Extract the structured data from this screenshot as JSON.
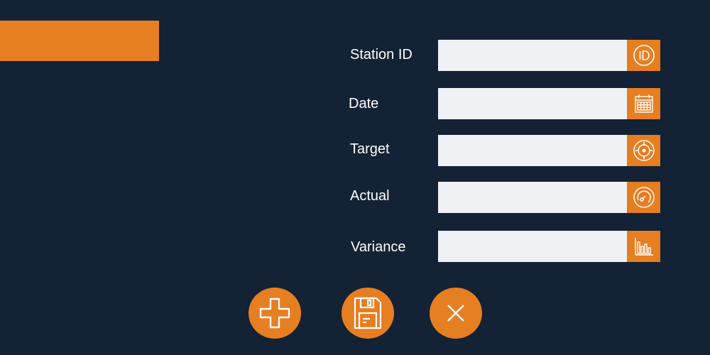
{
  "colors": {
    "background": "#132234",
    "accent": "#e67e22",
    "field_bg": "#f0f1f5",
    "text": "#ffffff"
  },
  "form": {
    "fields": [
      {
        "label": "Station ID",
        "value": "",
        "icon": "id-icon"
      },
      {
        "label": "Date",
        "value": "",
        "icon": "calendar-icon"
      },
      {
        "label": "Target",
        "value": "",
        "icon": "target-icon"
      },
      {
        "label": "Actual",
        "value": "",
        "icon": "gauge-icon"
      },
      {
        "label": "Variance",
        "value": "",
        "icon": "bar-chart-icon"
      }
    ]
  },
  "actions": [
    {
      "name": "add",
      "icon": "plus-icon"
    },
    {
      "name": "save",
      "icon": "floppy-disk-icon"
    },
    {
      "name": "cancel",
      "icon": "close-icon"
    }
  ]
}
